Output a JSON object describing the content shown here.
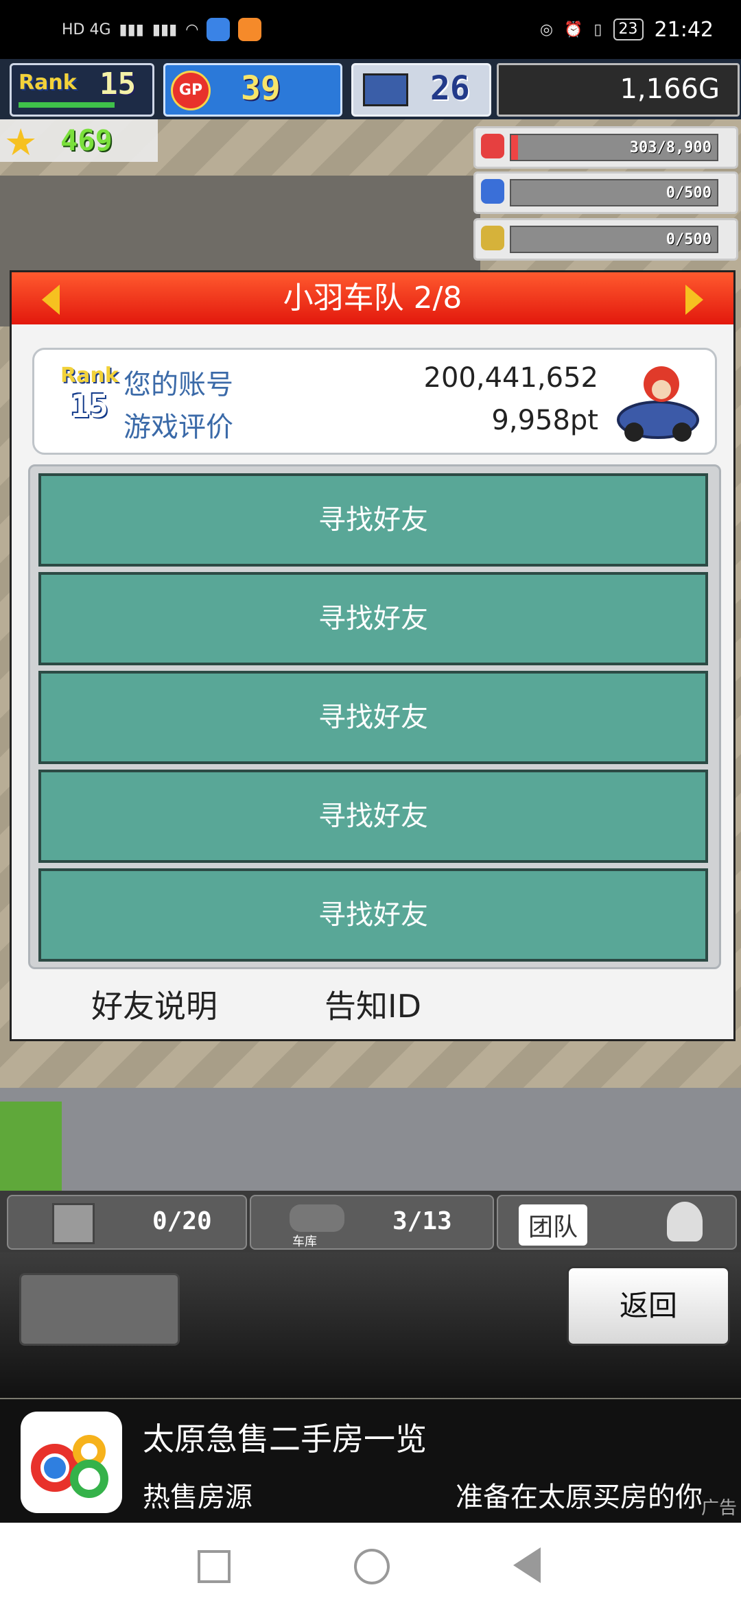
{
  "status_bar": {
    "network": "HD 4G",
    "battery": "23",
    "time": "21:42"
  },
  "hud": {
    "rank_label": "Rank",
    "rank": "15",
    "gp_label": "GP",
    "gp": "39",
    "pc_count": "26",
    "gold": "1,166G",
    "stars": "469"
  },
  "resources": [
    {
      "icon": "coin-stack-icon",
      "text": "303/8,900",
      "fraction": 0.034,
      "color": "#e64040"
    },
    {
      "icon": "bottle-icon",
      "text": "0/500",
      "fraction": 0.0,
      "color": "#3a6fd8"
    },
    {
      "icon": "wheat-icon",
      "text": "0/500",
      "fraction": 0.0,
      "color": "#d6b23a"
    }
  ],
  "panel": {
    "title": "小羽车队 2/8",
    "rank_label": "Rank",
    "rank": "15",
    "account_label": "您的账号",
    "account_value": "200,441,652",
    "rating_label": "游戏评价",
    "rating_value": "9,958pt",
    "friend_slots": [
      "寻找好友",
      "寻找好友",
      "寻找好友",
      "寻找好友",
      "寻找好友"
    ],
    "friend_help": "好友说明",
    "notify_id": "告知ID"
  },
  "tabbar": {
    "materials": "0/20",
    "garage_label": "车库",
    "garage": "3/13",
    "team_label": "团队"
  },
  "actions": {
    "back": "返回"
  },
  "ad": {
    "title": "太原急售二手房一览",
    "subtitle": "热售房源",
    "right_text": "准备在太原买房的你",
    "tag": "广告"
  }
}
